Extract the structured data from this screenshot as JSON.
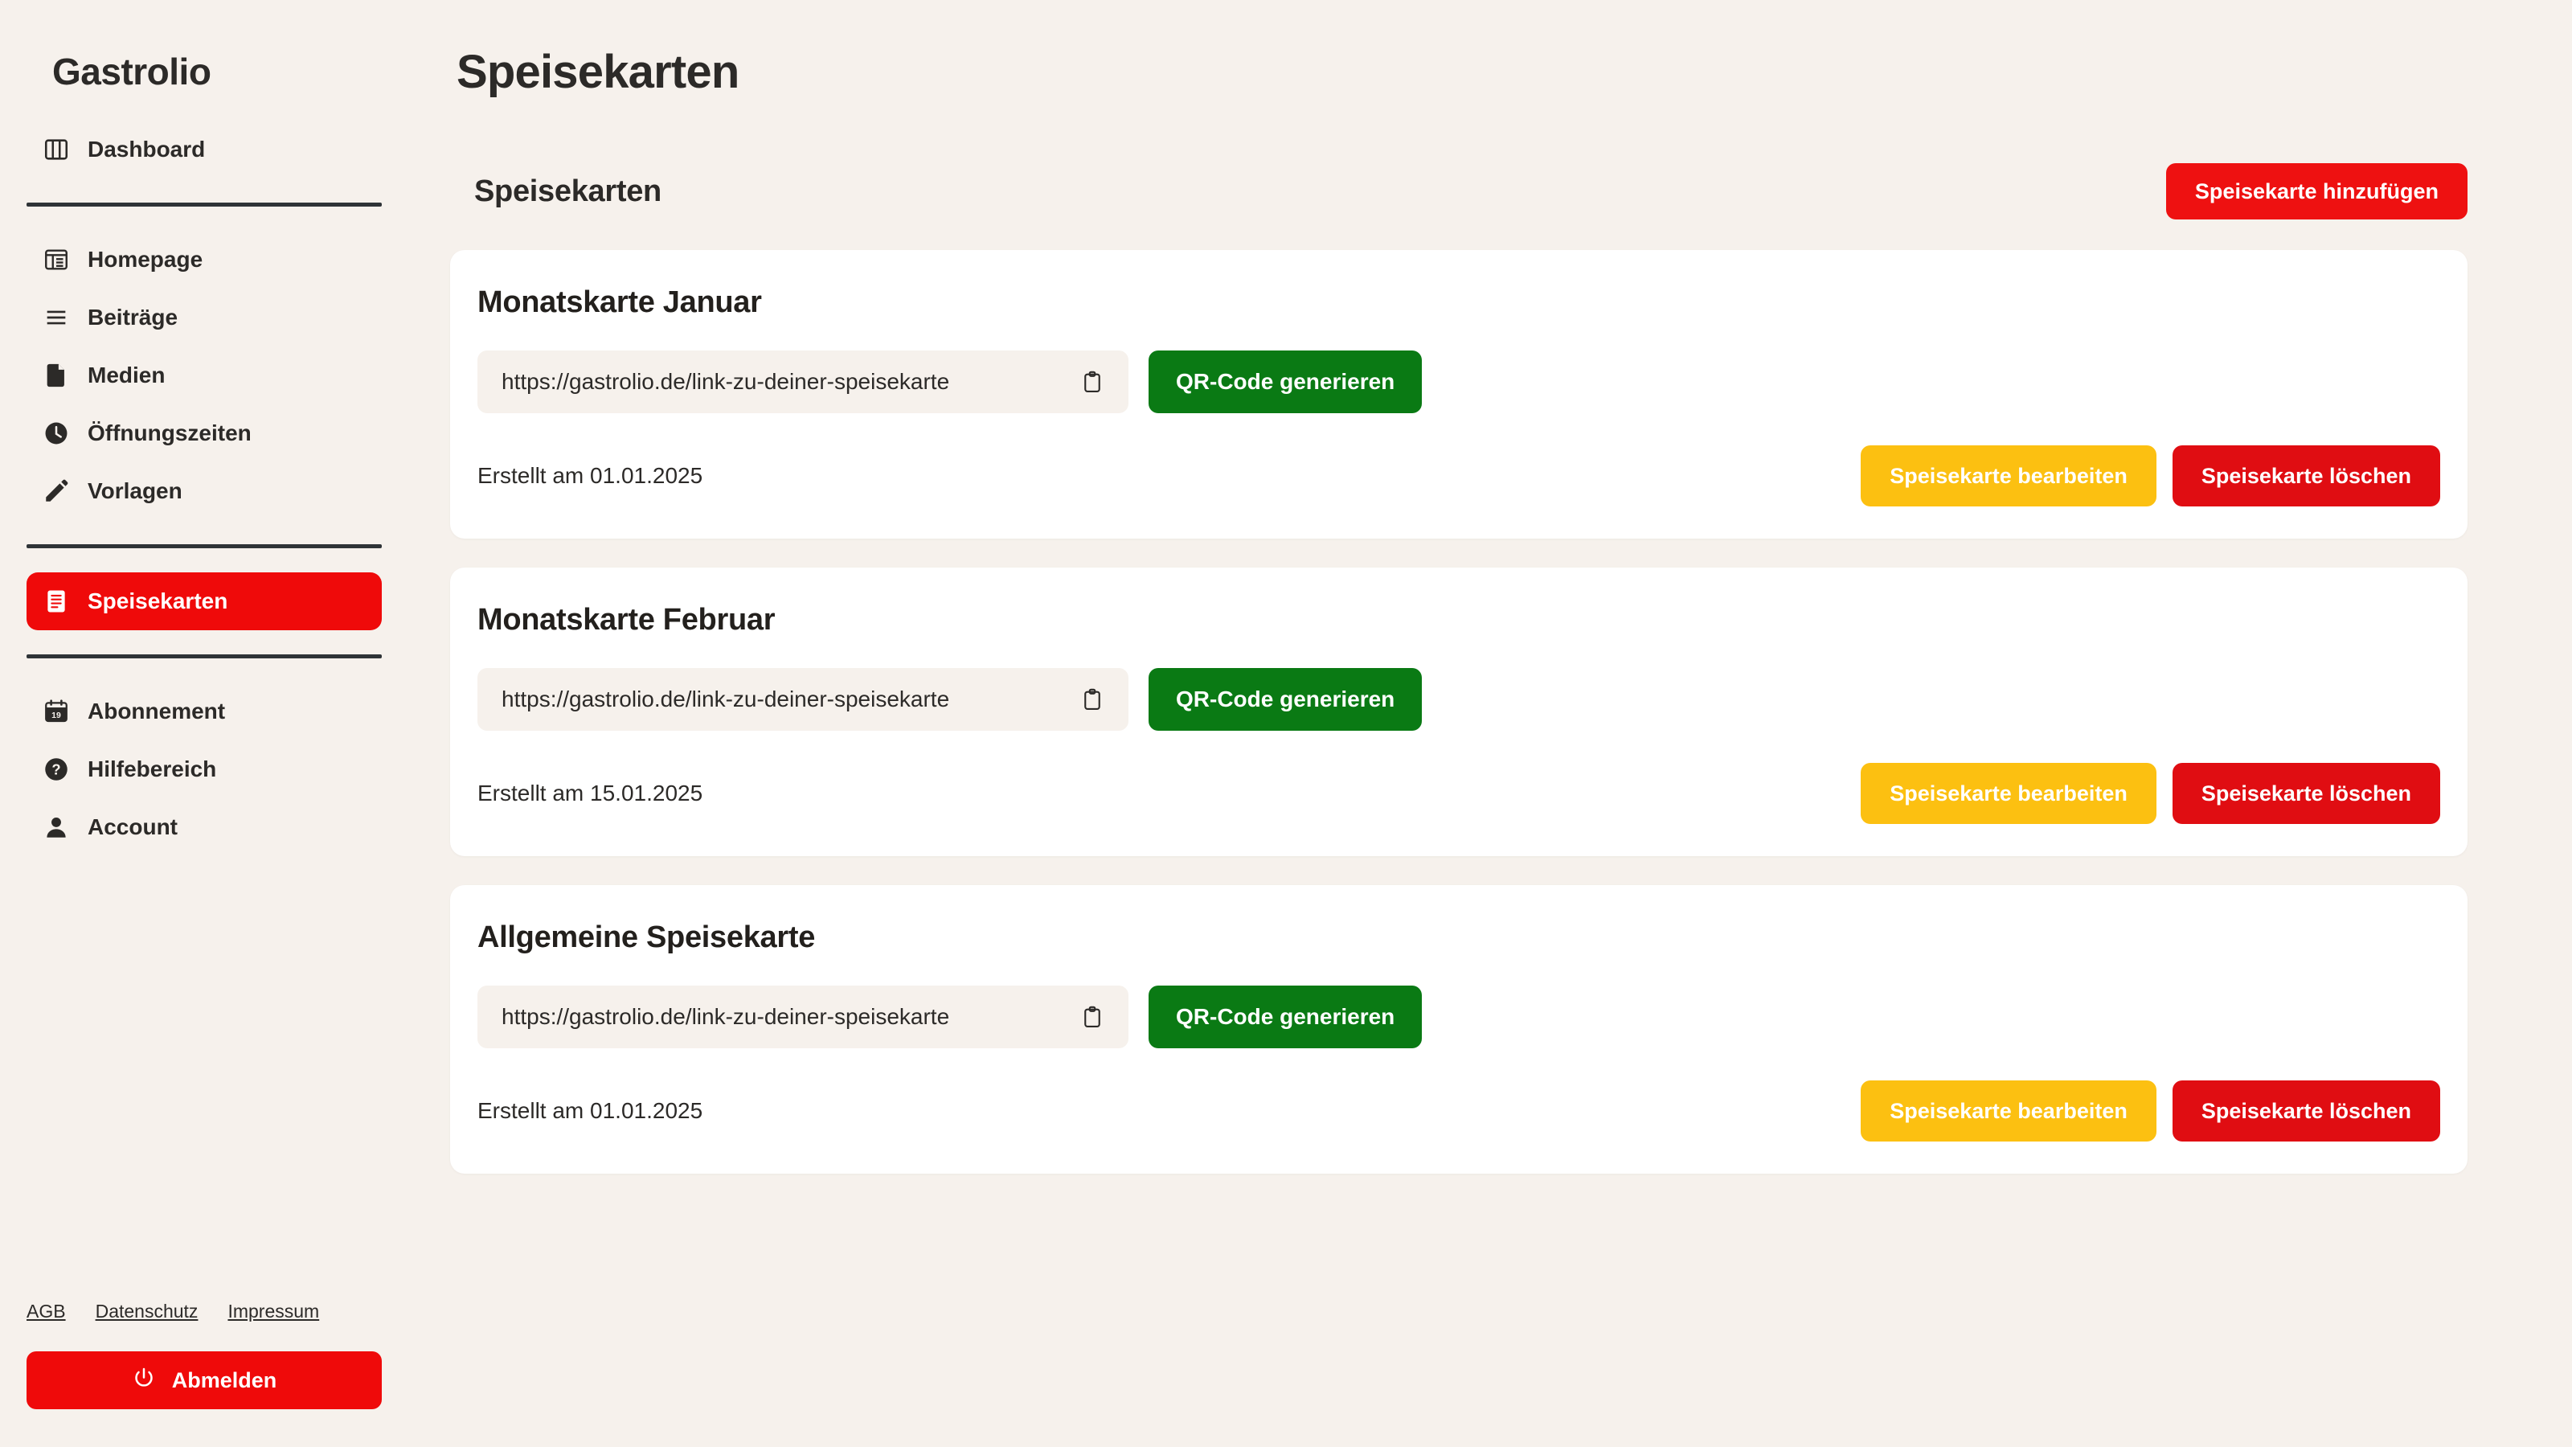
{
  "brand": "Gastrolio",
  "sidebar": {
    "groups": [
      {
        "items": [
          {
            "label": "Dashboard",
            "icon": "layout-columns-icon",
            "active": false
          }
        ]
      },
      {
        "items": [
          {
            "label": "Homepage",
            "icon": "homepage-icon",
            "active": false
          },
          {
            "label": "Beiträge",
            "icon": "list-lines-icon",
            "active": false
          },
          {
            "label": "Medien",
            "icon": "file-icon",
            "active": false
          },
          {
            "label": "Öffnungszeiten",
            "icon": "clock-icon",
            "active": false
          },
          {
            "label": "Vorlagen",
            "icon": "pencil-icon",
            "active": false
          }
        ]
      },
      {
        "items": [
          {
            "label": "Speisekarten",
            "icon": "menu-card-icon",
            "active": true
          }
        ]
      },
      {
        "items": [
          {
            "label": "Abonnement",
            "icon": "calendar-icon",
            "active": false
          },
          {
            "label": "Hilfebereich",
            "icon": "question-circle-icon",
            "active": false
          },
          {
            "label": "Account",
            "icon": "user-icon",
            "active": false
          }
        ]
      }
    ],
    "footer_links": [
      {
        "label": "AGB"
      },
      {
        "label": "Datenschutz"
      },
      {
        "label": "Impressum"
      }
    ],
    "logout_label": "Abmelden"
  },
  "main": {
    "page_title": "Speisekarten",
    "section_title": "Speisekarten",
    "add_button_label": "Speisekarte hinzufügen",
    "cards": [
      {
        "title": "Monatskarte Januar",
        "link": "https://gastrolio.de/link-zu-deiner-speisekarte",
        "qr_label": "QR-Code generieren",
        "created": "Erstellt am 01.01.2025",
        "edit_label": "Speisekarte bearbeiten",
        "delete_label": "Speisekarte löschen"
      },
      {
        "title": "Monatskarte Februar",
        "link": "https://gastrolio.de/link-zu-deiner-speisekarte",
        "qr_label": "QR-Code generieren",
        "created": "Erstellt am 15.01.2025",
        "edit_label": "Speisekarte bearbeiten",
        "delete_label": "Speisekarte löschen"
      },
      {
        "title": "Allgemeine Speisekarte",
        "link": "https://gastrolio.de/link-zu-deiner-speisekarte",
        "qr_label": "QR-Code generieren",
        "created": "Erstellt am 01.01.2025",
        "edit_label": "Speisekarte bearbeiten",
        "delete_label": "Speisekarte löschen"
      }
    ]
  },
  "colors": {
    "background": "#f6f1ec",
    "card": "#ffffff",
    "text": "#2c2a28",
    "accent_red": "#ef0a0a",
    "green": "#0a7a14",
    "yellow": "#fcc011",
    "delete_red": "#e00d12"
  }
}
